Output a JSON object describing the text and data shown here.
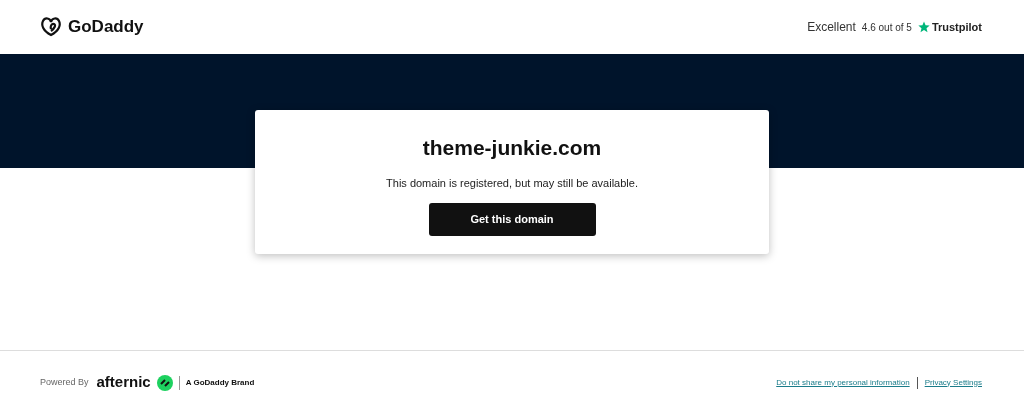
{
  "header": {
    "logo": "GoDaddy",
    "rating_word": "Excellent",
    "rating": "4.6 out of 5",
    "review_site": "Trustpilot"
  },
  "card": {
    "domain": "theme-junkie.com",
    "message": "This domain is registered, but may still be available.",
    "button": "Get this domain"
  },
  "footer": {
    "powered_by": "Powered By",
    "brand": "afternic",
    "brand_note": "A GoDaddy Brand",
    "links": [
      "Do not share my personal information",
      "Privacy Settings"
    ]
  }
}
